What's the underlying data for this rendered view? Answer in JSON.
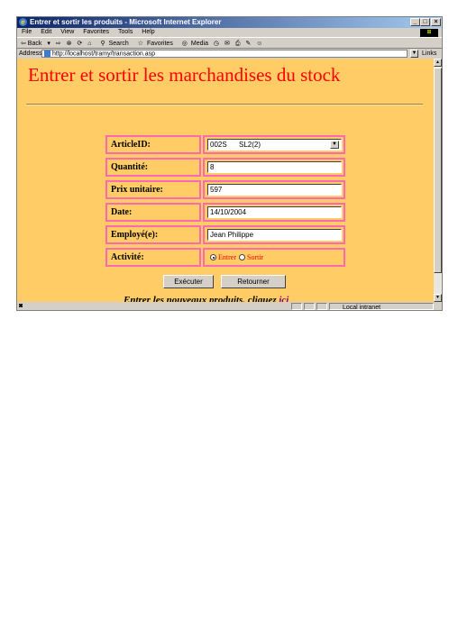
{
  "window": {
    "title": "Entrer et sortir les produits - Microsoft Internet Explorer"
  },
  "menu": [
    "File",
    "Edit",
    "View",
    "Favorites",
    "Tools",
    "Help"
  ],
  "toolbar": {
    "back": "⇦ Back",
    "forward": "⇨",
    "search": "Search",
    "favorites": "Favorites",
    "media": "Media"
  },
  "address": {
    "label": "Address",
    "url": "http://localhost/tramy/transaction.asp",
    "links": "Links »"
  },
  "page": {
    "title": "Entrer et sortir les marchandises du stock",
    "fields": {
      "article": {
        "label": "ArticleID:",
        "value": "002S      SL2(2)"
      },
      "quantite": {
        "label": "Quantité:",
        "value": "8"
      },
      "prix": {
        "label": "Prix unitaire:",
        "value": "597"
      },
      "date": {
        "label": "Date:",
        "value": "14/10/2004"
      },
      "employe": {
        "label": "Employé(e):",
        "value": "Jean Philippe"
      },
      "activite": {
        "label": "Activité:",
        "options": [
          "Entrer",
          "Sortir"
        ],
        "selected": "Entrer"
      }
    },
    "buttons": {
      "execute": "Exécuter",
      "return": "Retourner"
    },
    "footer": {
      "text": "Entrer les nouveaux produits, cliquez ",
      "link": "ici"
    }
  },
  "status": {
    "zone": "Local intranet"
  },
  "colors": {
    "page_bg": "#ffcc66",
    "title": "#ff0000",
    "border": "#ff69b4"
  }
}
